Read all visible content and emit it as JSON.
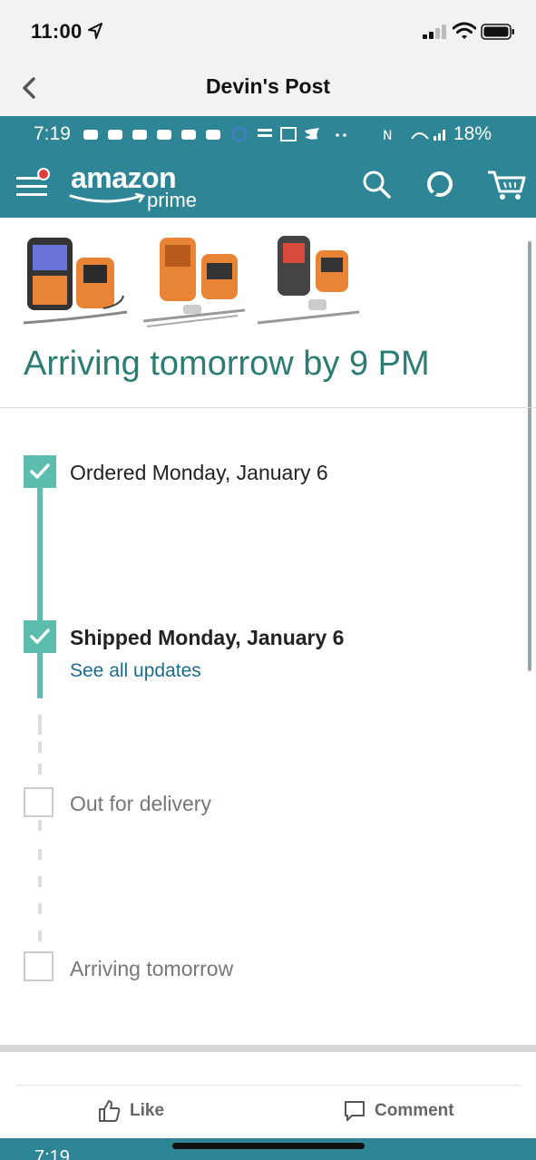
{
  "ios_status": {
    "time": "11:00"
  },
  "fb_header": {
    "title": "Devin's Post"
  },
  "amazon_status": {
    "time": "7:19",
    "battery": "18%"
  },
  "amazon_nav": {
    "logo_word": "amazon",
    "logo_sub": "prime"
  },
  "delivery": {
    "headline": "Arriving tomorrow by 9 PM"
  },
  "timeline": {
    "ordered": "Ordered Monday, January 6",
    "shipped": "Shipped Monday, January 6",
    "see_all": "See all updates",
    "out_for_delivery": "Out for delivery",
    "arriving": "Arriving tomorrow"
  },
  "post_actions": {
    "like": "Like",
    "comment": "Comment"
  },
  "peek": {
    "time": "7:19"
  },
  "colors": {
    "amazon_teal": "#2e8595",
    "timeline_green": "#5cbcae",
    "headline_green": "#2b7d73",
    "link_blue": "#1a6c8a"
  }
}
